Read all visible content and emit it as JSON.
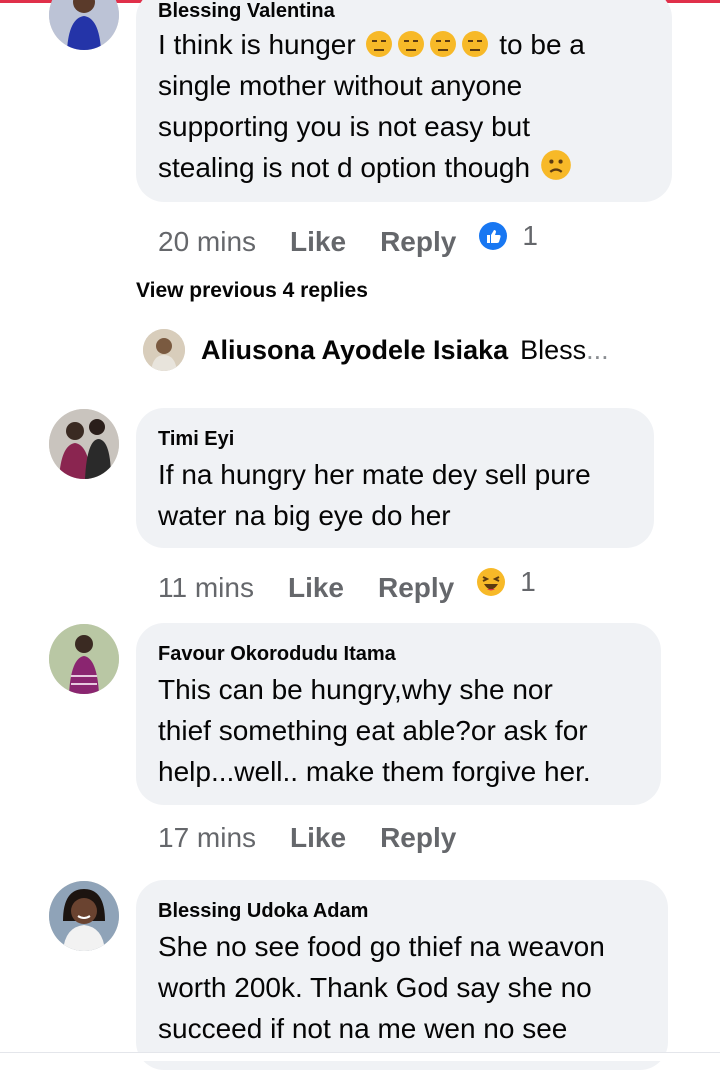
{
  "comments": [
    {
      "name": "Blessing Valentina",
      "lines": [
        "I think is hunger",
        "to be a",
        "single mother without anyone",
        "supporting you is not easy but",
        "stealing is not d option though"
      ],
      "time": "20 mins",
      "like_label": "Like",
      "reply_label": "Reply",
      "reaction_icon": "like-reaction-icon",
      "reaction_count": "1"
    },
    {
      "name": "Timi Eyi",
      "lines": [
        "If na hungry her mate dey sell pure",
        "water na big eye do her"
      ],
      "time": "11 mins",
      "like_label": "Like",
      "reply_label": "Reply",
      "reaction_icon": "haha-reaction-icon",
      "reaction_count": "1"
    },
    {
      "name": "Favour Okorodudu Itama",
      "lines": [
        "This can be hungry,why she nor",
        "thief something eat able?or ask for",
        "help...well.. make them forgive her."
      ],
      "time": "17 mins",
      "like_label": "Like",
      "reply_label": "Reply"
    },
    {
      "name": "Blessing Udoka Adam",
      "lines": [
        "She no see food go thief na weavon",
        "worth 200k.  Thank God say she no",
        "succeed if not na me wen no see"
      ]
    }
  ],
  "view_previous": "View previous 4 replies",
  "reply_preview": {
    "name": "Aliusona Ayodele Isiaka",
    "text": "Bless",
    "ellipsis": "..."
  },
  "colors": {
    "bubble": "#f0f2f5",
    "meta": "#65676b",
    "like_blue": "#1877f2",
    "top_accent": "#e0304a"
  }
}
